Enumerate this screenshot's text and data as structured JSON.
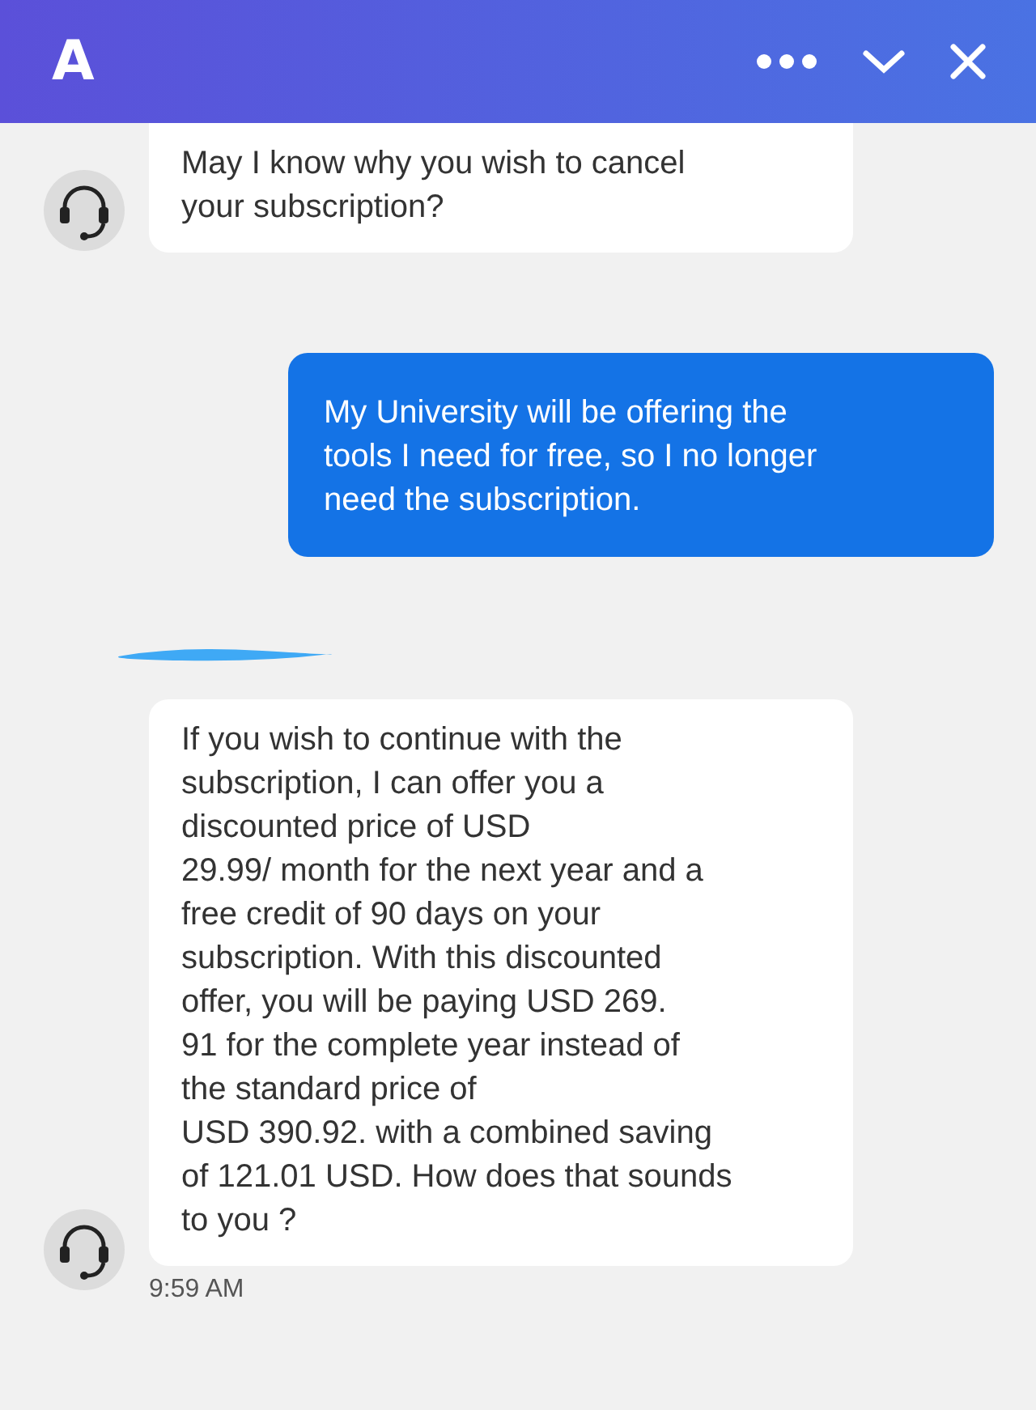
{
  "header": {
    "logo": "A"
  },
  "messages": [
    {
      "kind": "agent",
      "text": "May I know why you wish to cancel\nyour subscription?"
    },
    {
      "kind": "user",
      "text": "My University will be offering the\ntools I need for free, so I no longer\nneed the subscription."
    },
    {
      "kind": "redaction"
    },
    {
      "kind": "agent",
      "text": "If you wish to continue with the\nsubscription, I can offer you a\ndiscounted price of USD\n29.99/ month for the next year and a\nfree credit of 90 days on your\nsubscription. With this discounted\noffer, you will be paying USD 269.\n91 for the complete year instead of\nthe standard price of\nUSD 390.92. with a combined saving\nof 121.01 USD. How does that sounds\nto you ?",
      "time": "9:59 AM"
    }
  ]
}
